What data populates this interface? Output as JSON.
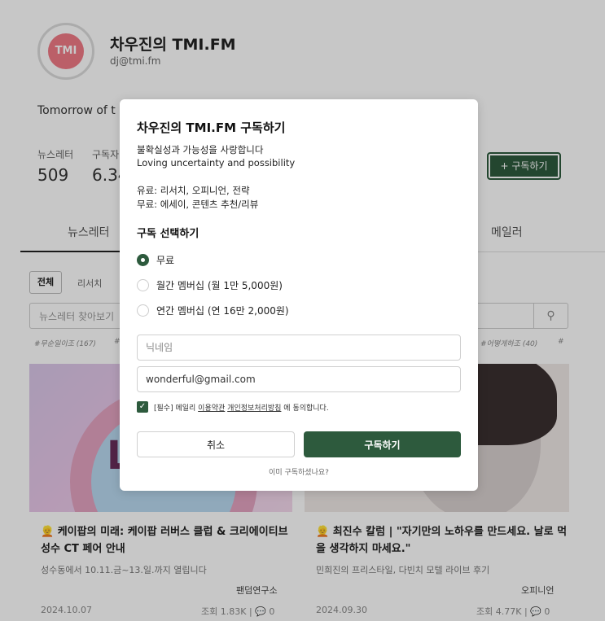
{
  "profile": {
    "logo_text": "TMI",
    "title": "차우진의 TMI.FM",
    "email": "dj@tmi.fm",
    "tagline": "Tomorrow of t"
  },
  "stats": [
    {
      "label": "뉴스레터",
      "value": "509"
    },
    {
      "label": "구독자",
      "value": "6.34"
    }
  ],
  "header": {
    "subscribe_button": "+ 구독하기"
  },
  "tabs": [
    "뉴스레터",
    "메일러"
  ],
  "filters": {
    "chips": [
      "전체",
      "리서치"
    ]
  },
  "search": {
    "placeholder": "뉴스레터 찾아보기"
  },
  "hashtags": [
    "#무순일이조 (167)",
    "#",
    "#어떻게하조 (40)",
    "#"
  ],
  "cards": [
    {
      "image_text": "LO",
      "title": "👱 케이팝의 미래: 케이팝 러버스 클럽 & 크리에이티브 성수 CT 페어 안내",
      "desc": "성수동에서 10.11.금~13.일.까지 열립니다",
      "category": "팬덤연구소",
      "date": "2024.10.07",
      "meta": "조회 1.83K | 💬 0"
    },
    {
      "title": "👱 최진수 칼럼 | \"자기만의 노하우를 만드세요. 날로 먹을 생각하지 마세요.\"",
      "desc": "민희진의 프리스타일, 다빈치 모텔 라이브 후기",
      "category": "오피니언",
      "date": "2024.09.30",
      "meta": "조회 4.77K | 💬 0"
    }
  ],
  "modal": {
    "title": "차우진의 TMI.FM 구독하기",
    "desc_lines": [
      "불확실성과 가능성을 사랑합니다",
      "Loving uncertainty and possibility",
      "유료: 리서치, 오피니언, 전략",
      "무료: 에세이, 콘텐츠 추천/리뷰"
    ],
    "section_title": "구독 선택하기",
    "options": [
      {
        "label": "무료",
        "checked": true
      },
      {
        "label": "월간 멤버십 (월 1만 5,000원)",
        "checked": false
      },
      {
        "label": "연간 멤버십 (연 16만 2,000원)",
        "checked": false
      }
    ],
    "nickname_placeholder": "닉네임",
    "email_value": "wonderful@gmail.com",
    "agree": {
      "prefix": "[필수] 메일리",
      "terms_link": "이용약관",
      "privacy_link": "개인정보처리방침",
      "suffix": "에 동의합니다.",
      "checked": true
    },
    "cancel_label": "취소",
    "submit_label": "구독하기",
    "already_label": "이미 구독하셨나요?"
  },
  "colors": {
    "accent": "#2d5a3d",
    "overlay": "rgba(0,0,0,0.22)"
  }
}
